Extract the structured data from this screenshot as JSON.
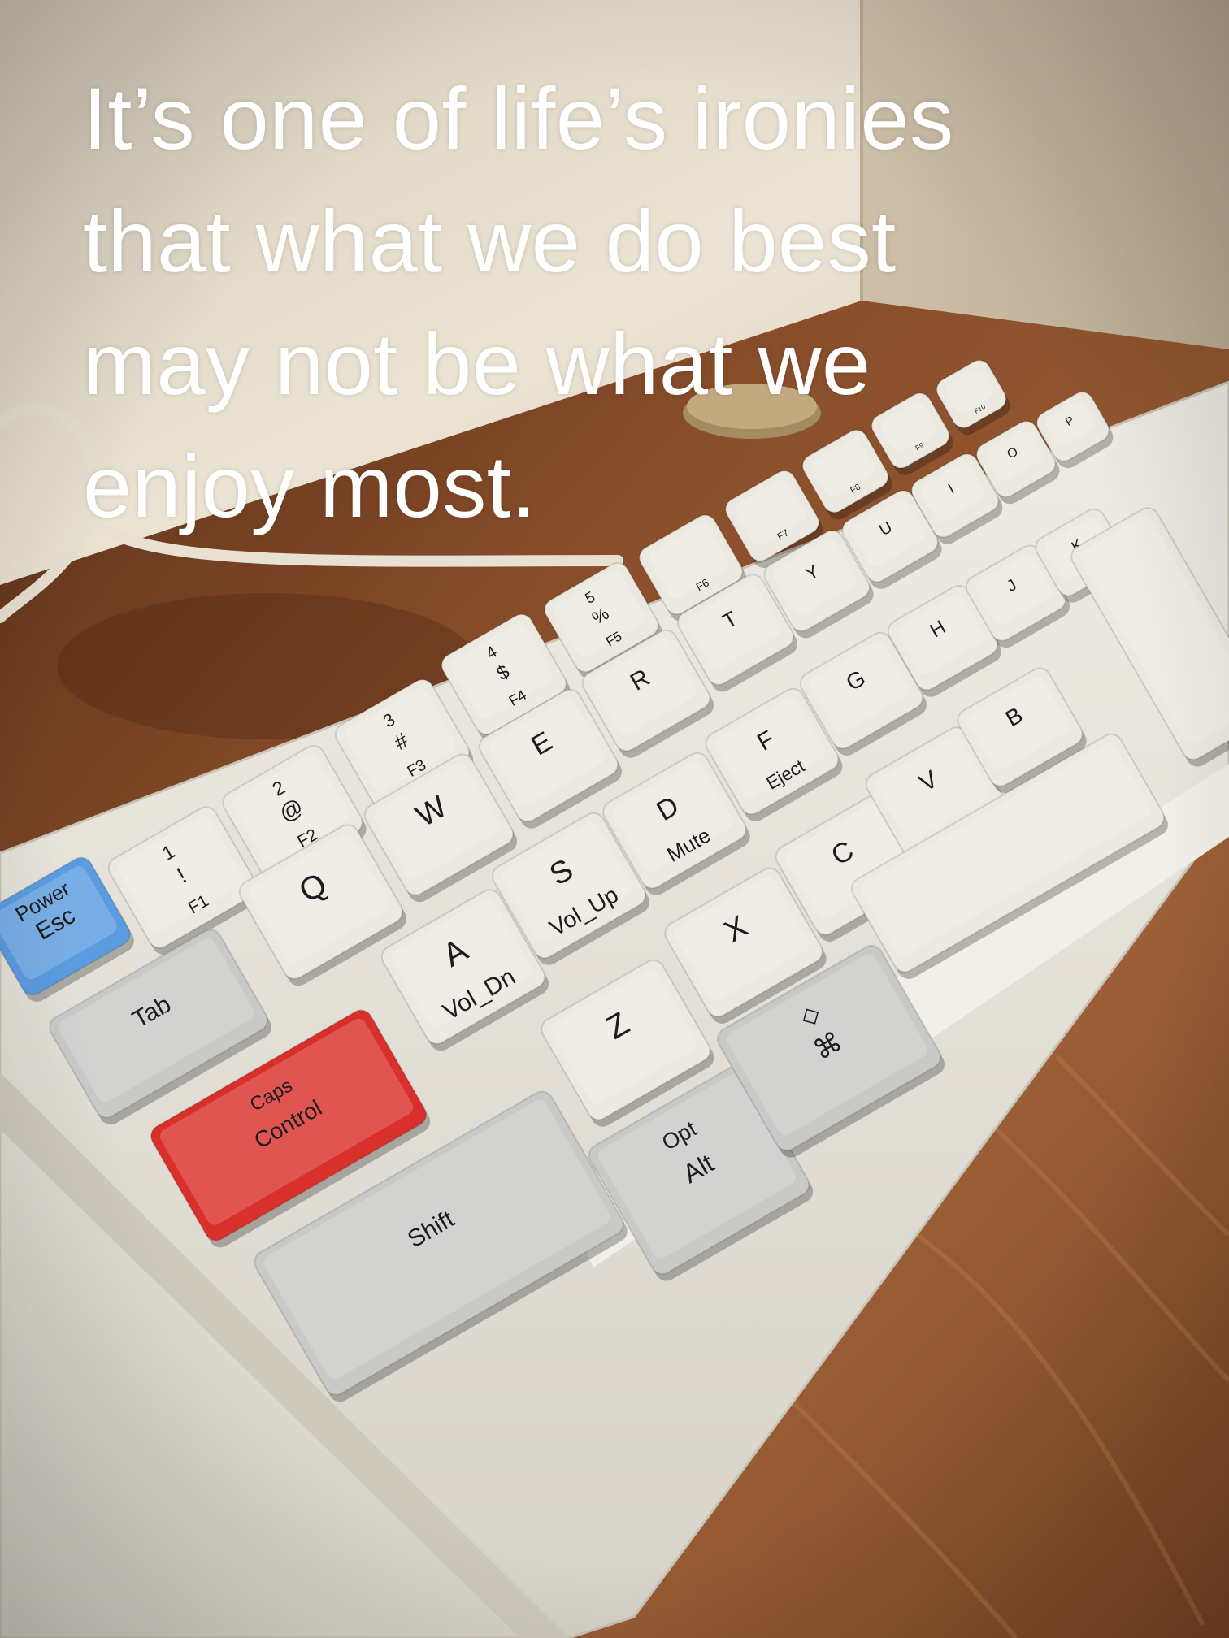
{
  "quote": {
    "lines": [
      "It’s one of life’s ironies",
      "that what we do best",
      "may not be what we",
      "enjoy most."
    ]
  },
  "keyboard": {
    "keys": [
      {
        "id": "esc",
        "legend": "Esc",
        "sublegend": "Power",
        "color": "#5b9be0"
      },
      {
        "id": "1",
        "legend": "!",
        "sublegend": "1",
        "fn": "F1",
        "color": "#ece9e1"
      },
      {
        "id": "2",
        "legend": "@",
        "sublegend": "2",
        "fn": "F2",
        "color": "#ece9e1"
      },
      {
        "id": "3",
        "legend": "#",
        "sublegend": "3",
        "fn": "F3",
        "color": "#ece9e1"
      },
      {
        "id": "4",
        "legend": "$",
        "sublegend": "4",
        "fn": "F4",
        "color": "#ece9e1"
      },
      {
        "id": "5",
        "legend": "%",
        "sublegend": "5",
        "fn": "F5",
        "color": "#ece9e1"
      },
      {
        "id": "6",
        "fn": "F6",
        "color": "#ece9e1"
      },
      {
        "id": "7",
        "fn": "F7",
        "color": "#ece9e1"
      },
      {
        "id": "8",
        "fn": "F8",
        "color": "#ece9e1"
      },
      {
        "id": "9",
        "fn": "F9",
        "color": "#ece9e1"
      },
      {
        "id": "0",
        "fn": "F10",
        "color": "#ece9e1"
      },
      {
        "id": "tab",
        "legend": "Tab",
        "color": "#c9c9c7"
      },
      {
        "id": "q",
        "legend": "Q",
        "color": "#ece9e1"
      },
      {
        "id": "w",
        "legend": "W",
        "color": "#ece9e1"
      },
      {
        "id": "e",
        "legend": "E",
        "color": "#ece9e1"
      },
      {
        "id": "r",
        "legend": "R",
        "color": "#ece9e1"
      },
      {
        "id": "t",
        "legend": "T",
        "color": "#ece9e1"
      },
      {
        "id": "y",
        "legend": "Y",
        "color": "#ece9e1"
      },
      {
        "id": "u",
        "legend": "U",
        "color": "#ece9e1"
      },
      {
        "id": "i",
        "legend": "I",
        "color": "#ece9e1"
      },
      {
        "id": "o",
        "legend": "O",
        "color": "#ece9e1"
      },
      {
        "id": "p",
        "legend": "P",
        "color": "#ece9e1"
      },
      {
        "id": "control",
        "legend": "Control",
        "sublegend": "Caps",
        "color": "#d9302c"
      },
      {
        "id": "a",
        "legend": "A",
        "fn": "Vol_Dn",
        "color": "#ece9e1"
      },
      {
        "id": "s",
        "legend": "S",
        "fn": "Vol_Up",
        "color": "#ece9e1"
      },
      {
        "id": "d",
        "legend": "D",
        "fn": "Mute",
        "color": "#ece9e1"
      },
      {
        "id": "f",
        "legend": "F",
        "fn": "Eject",
        "color": "#ece9e1"
      },
      {
        "id": "g",
        "legend": "G",
        "color": "#ece9e1"
      },
      {
        "id": "h",
        "legend": "H",
        "color": "#ece9e1"
      },
      {
        "id": "j",
        "legend": "J",
        "color": "#ece9e1"
      },
      {
        "id": "k",
        "legend": "K",
        "color": "#ece9e1"
      },
      {
        "id": "shift",
        "legend": "Shift",
        "color": "#c9c9c7"
      },
      {
        "id": "z",
        "legend": "Z",
        "color": "#ece9e1"
      },
      {
        "id": "x",
        "legend": "X",
        "color": "#ece9e1"
      },
      {
        "id": "c",
        "legend": "C",
        "color": "#ece9e1"
      },
      {
        "id": "v",
        "legend": "V",
        "color": "#ece9e1"
      },
      {
        "id": "b",
        "legend": "B",
        "color": "#ece9e1"
      },
      {
        "id": "alt",
        "legend": "Alt",
        "sublegend": "Opt",
        "color": "#c9c9c7"
      },
      {
        "id": "cmd",
        "legend": "⌘",
        "sublegend": "◇",
        "color": "#c9c9c7"
      },
      {
        "id": "space",
        "legend": "",
        "color": "#ece9e1"
      },
      {
        "id": "enter",
        "legend": "",
        "color": "#ece9e1"
      }
    ]
  },
  "colors": {
    "wall": "#e6ddcd",
    "desk": "#7a4526",
    "case": "#e9e6de",
    "accent_blue": "#5b9be0",
    "accent_red": "#d9302c",
    "gray_modifier": "#c9c9c7"
  }
}
